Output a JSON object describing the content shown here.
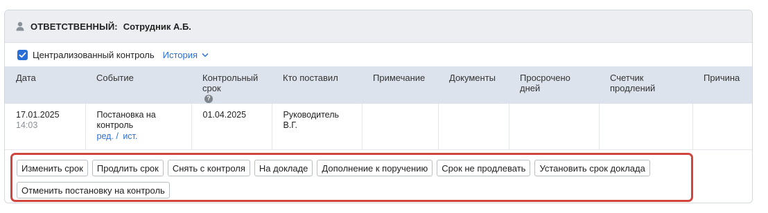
{
  "header": {
    "label": "ОТВЕТСТВЕННЫЙ:",
    "name": "Сотрудник А.Б."
  },
  "control": {
    "checkbox_label": "Централизованный контроль",
    "checked": true,
    "history_link": "История"
  },
  "table": {
    "columns": [
      "Дата",
      "Событие",
      "Контрольный срок",
      "Кто поставил",
      "Примечание",
      "Документы",
      "Просрочено дней",
      "Счетчик продлений",
      "Причина"
    ],
    "rows": [
      {
        "date": "17.01.2025",
        "time": "14:03",
        "event": "Постановка на контроль",
        "edit_link": "ред. /",
        "source_link": "ист.",
        "deadline": "01.04.2025",
        "who_set": "Руководитель В.Г.",
        "note": "",
        "documents": "",
        "overdue_days": "",
        "extension_count": "",
        "reason": ""
      }
    ]
  },
  "actions": {
    "row1": [
      "Изменить срок",
      "Продлить срок",
      "Снять с контроля",
      "На докладе",
      "Дополнение к поручению",
      "Срок не продлевать",
      "Установить срок доклада"
    ],
    "row2": [
      "Отменить постановку на контроль"
    ]
  },
  "colors": {
    "accent": "#2a6fd8",
    "highlight_border": "#d2453f",
    "header_bg": "#dde3ec"
  }
}
